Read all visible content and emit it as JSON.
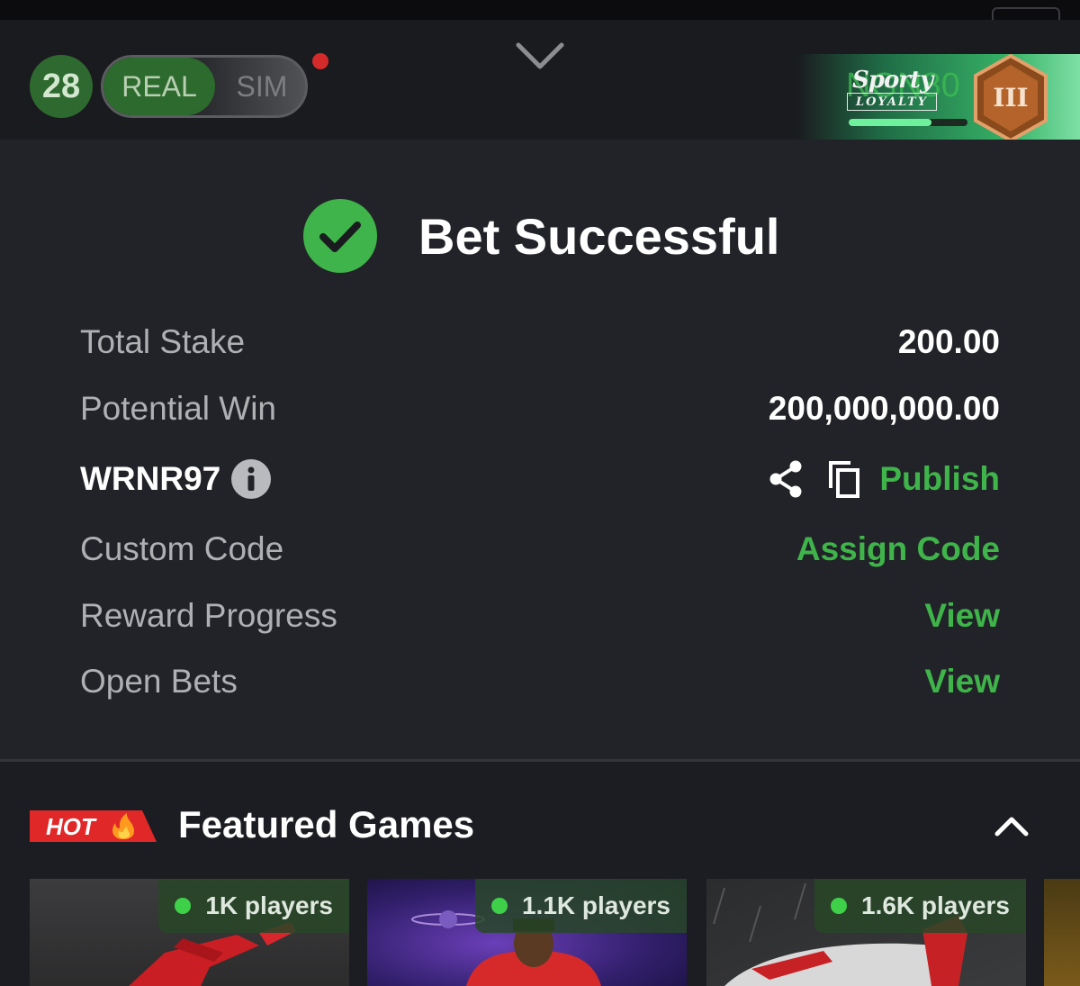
{
  "header": {
    "level": "28",
    "mode_real": "REAL",
    "mode_sim": "SIM",
    "loyalty": {
      "amount": "NGN80",
      "logo_main": "Sporty",
      "logo_sub": "LOYALTY",
      "tier": "III",
      "progress": 0.7
    }
  },
  "bet": {
    "title": "Bet Successful",
    "rows": {
      "total_stake": {
        "label": "Total Stake",
        "value": "200.00"
      },
      "potential_win": {
        "label": "Potential Win",
        "value": "200,000,000.00"
      },
      "booking": {
        "code": "WRNR97",
        "publish": "Publish"
      },
      "custom_code": {
        "label": "Custom Code",
        "action": "Assign Code"
      },
      "reward_progress": {
        "label": "Reward Progress",
        "action": "View"
      },
      "open_bets": {
        "label": "Open Bets",
        "action": "View"
      }
    }
  },
  "featured": {
    "hot": "HOT",
    "title": "Featured Games",
    "games": [
      {
        "players": "1K players"
      },
      {
        "players": "1.1K players"
      },
      {
        "players": "1.6K players"
      }
    ]
  },
  "colors": {
    "accent_green": "#3fb44a",
    "panel": "#222328",
    "hot_red": "#e02828"
  }
}
